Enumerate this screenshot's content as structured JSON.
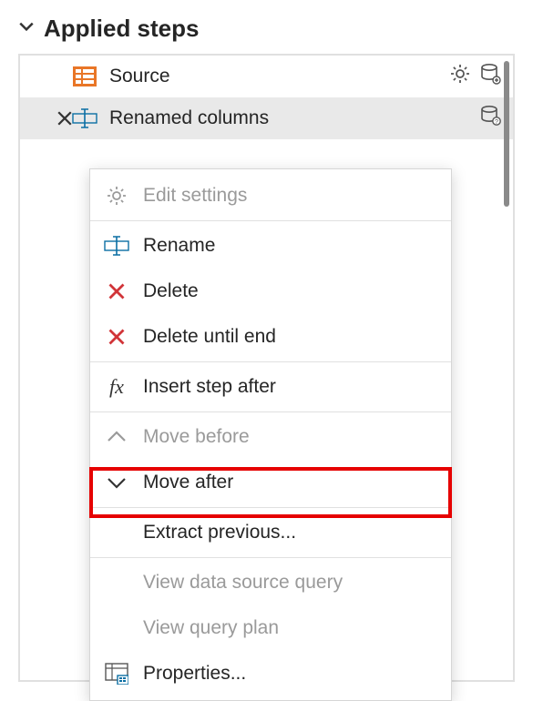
{
  "header": {
    "title": "Applied steps"
  },
  "steps": {
    "source": {
      "label": "Source"
    },
    "renamed": {
      "label": "Renamed columns"
    }
  },
  "menu": {
    "edit_settings": "Edit settings",
    "rename": "Rename",
    "delete": "Delete",
    "delete_until_end": "Delete until end",
    "insert_step_after": "Insert step after",
    "move_before": "Move before",
    "move_after": "Move after",
    "extract_previous": "Extract previous...",
    "view_data_source_query": "View data source query",
    "view_query_plan": "View query plan",
    "properties": "Properties..."
  }
}
